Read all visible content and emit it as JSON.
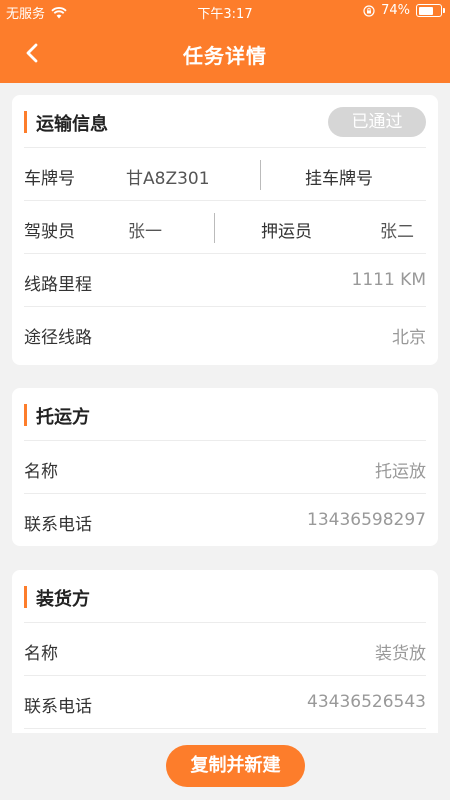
{
  "status_bar": {
    "carrier": "无服务",
    "time": "下午3:17",
    "battery": "74%",
    "battery_level": 0.74
  },
  "nav": {
    "title": "任务详情",
    "back_icon": "chevron-left-icon"
  },
  "transport": {
    "title": "运输信息",
    "status": "已通过",
    "plate_label": "车牌号",
    "plate_value": "甘A8Z301",
    "trailer_label": "挂车牌号",
    "driver_label": "驾驶员",
    "driver_value": "张一",
    "escort_label": "押运员",
    "escort_value": "张二",
    "mileage_label": "线路里程",
    "mileage_value": "1111 KM",
    "route_label": "途径线路",
    "route_value": "北京"
  },
  "consignor": {
    "title": "托运方",
    "name_label": "名称",
    "name_value": "托运放",
    "phone_label": "联系电话",
    "phone_value": "13436598297"
  },
  "loader": {
    "title": "装货方",
    "name_label": "名称",
    "name_value": "装货放",
    "phone_label": "联系电话",
    "phone_value": "43436526543"
  },
  "actions": {
    "copy_new_label": "复制并新建"
  },
  "colors": {
    "accent": "#fd7d2b",
    "badge_bg": "#d6d6d6",
    "background": "#f2f2f2"
  }
}
